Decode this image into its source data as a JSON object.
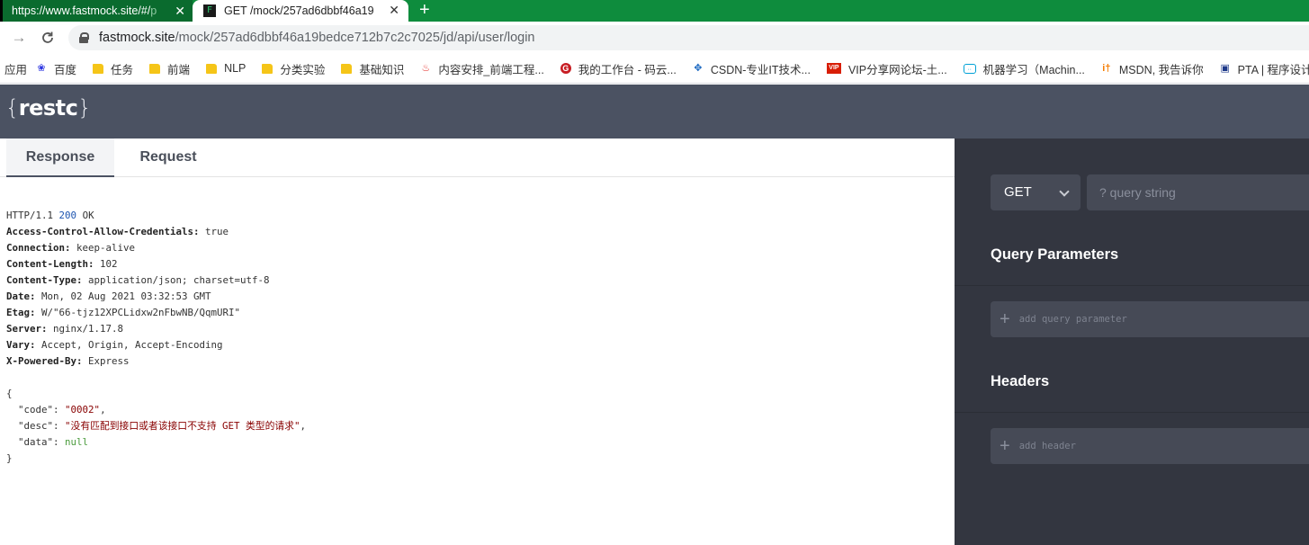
{
  "browser": {
    "tabs": [
      {
        "title_main": "https://www.fastmock.site/#/",
        "title_faded": "p",
        "active": false
      },
      {
        "title": "GET /mock/257ad6dbbf46a19",
        "favicon": "F",
        "active": true
      }
    ],
    "close_glyph": "✕",
    "new_tab_glyph": "+",
    "address": {
      "host": "fastmock.site",
      "path": "/mock/257ad6dbbf46a19bedce712b7c2c7025/jd/api/user/login"
    },
    "back_glyph": "→",
    "reload_glyph": "C"
  },
  "bookmarks": [
    {
      "label": "应用",
      "icon": "apps-icon"
    },
    {
      "label": "百度",
      "icon": "baidu-icon"
    },
    {
      "label": "任务",
      "icon": "folder-icon"
    },
    {
      "label": "前端",
      "icon": "folder-icon"
    },
    {
      "label": "NLP",
      "icon": "folder-icon"
    },
    {
      "label": "分类实验",
      "icon": "folder-icon"
    },
    {
      "label": "基础知识",
      "icon": "folder-icon"
    },
    {
      "label": "内容安排_前端工程...",
      "icon": "fire-icon"
    },
    {
      "label": "我的工作台 - 码云...",
      "icon": "gitee-icon"
    },
    {
      "label": "CSDN-专业IT技术...",
      "icon": "csdn-icon"
    },
    {
      "label": "VIP分享网论坛-土...",
      "icon": "vip-icon"
    },
    {
      "label": "机器学习（Machin...",
      "icon": "bilibili-icon"
    },
    {
      "label": "MSDN, 我告诉你",
      "icon": "msdn-icon"
    },
    {
      "label": "PTA | 程序设计",
      "icon": "pta-icon"
    }
  ],
  "app": {
    "logo": {
      "open": "{",
      "word": "restc",
      "close": "}"
    },
    "tabs": {
      "response": "Response",
      "request": "Request"
    },
    "response": {
      "status_line": {
        "protocol": "HTTP/1.1",
        "code": "200",
        "text": "OK"
      },
      "headers": [
        {
          "key": "Access-Control-Allow-Credentials",
          "value": "true"
        },
        {
          "key": "Connection",
          "value": "keep-alive"
        },
        {
          "key": "Content-Length",
          "value": "102"
        },
        {
          "key": "Content-Type",
          "value": "application/json; charset=utf-8"
        },
        {
          "key": "Date",
          "value": "Mon, 02 Aug 2021 03:32:53 GMT"
        },
        {
          "key": "Etag",
          "value": "W/\"66-tjz12XPCLidxw2nFbwNB/QqmURI\""
        },
        {
          "key": "Server",
          "value": "nginx/1.17.8"
        },
        {
          "key": "Vary",
          "value": "Accept, Origin, Accept-Encoding"
        },
        {
          "key": "X-Powered-By",
          "value": "Express"
        }
      ],
      "body": {
        "open": "{",
        "close": "}",
        "code_key": "\"code\"",
        "code_value": "\"0002\"",
        "desc_key": "\"desc\"",
        "desc_value": "\"没有匹配到接口或者该接口不支持 GET 类型的请求\"",
        "data_key": "\"data\"",
        "data_value": "null"
      }
    },
    "sidebar": {
      "method": "GET",
      "query_placeholder": "? query string",
      "query_params_title": "Query Parameters",
      "add_query_param": "add query parameter",
      "headers_title": "Headers",
      "add_header": "add header",
      "plus_glyph": "+"
    }
  }
}
